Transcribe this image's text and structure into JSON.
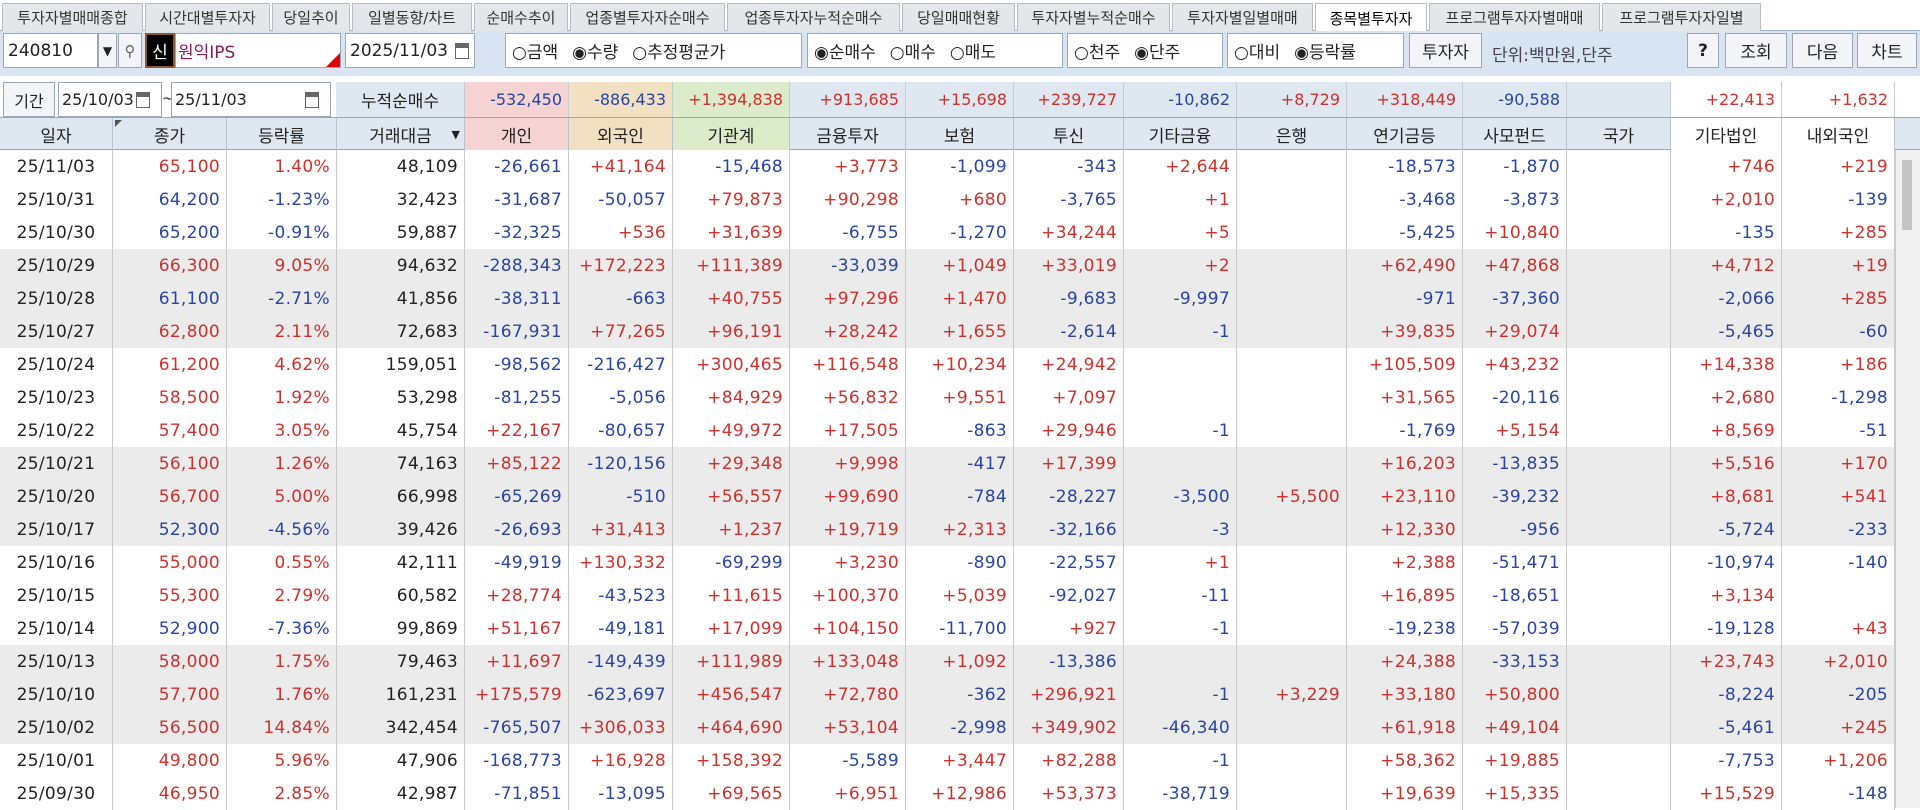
{
  "tabs": [
    "투자자별매매종합",
    "시간대별투자자",
    "당일추이",
    "일별동향/차트",
    "순매수추이",
    "업종별투자자순매수",
    "업종투자자누적순매수",
    "당일매매현황",
    "투자자별누적순매수",
    "투자자별일별매매",
    "종목별투자자",
    "프로그램투자자별매매",
    "프로그램투자자일별"
  ],
  "active_tab": "종목별투자자",
  "toolbar": {
    "code": "240810",
    "new_badge": "신",
    "stock_name": "원익IPS",
    "date": "2025/11/03",
    "group1": [
      {
        "label": "금액",
        "checked": false
      },
      {
        "label": "수량",
        "checked": true
      },
      {
        "label": "추정평균가",
        "checked": false
      }
    ],
    "group2": [
      {
        "label": "순매수",
        "checked": true
      },
      {
        "label": "매수",
        "checked": false
      },
      {
        "label": "매도",
        "checked": false
      }
    ],
    "group3": [
      {
        "label": "천주",
        "checked": false
      },
      {
        "label": "단주",
        "checked": true
      }
    ],
    "group4": [
      {
        "label": "대비",
        "checked": false
      },
      {
        "label": "등락률",
        "checked": true
      }
    ],
    "investor_btn": "투자자",
    "unit": "단위:백만원,단주",
    "help_btn": "?",
    "query_btn": "조회",
    "next_btn": "다음",
    "chart_btn": "차트"
  },
  "period": {
    "label": "기간",
    "from": "25/10/03",
    "sep": "~",
    "to": "25/11/03",
    "cum_label": "누적순매수"
  },
  "cumulative": [
    "-532,450",
    "-886,433",
    "+1,394,838",
    "+913,685",
    "+15,698",
    "+239,727",
    "-10,862",
    "+8,729",
    "+318,449",
    "-90,588",
    "",
    "+22,413",
    "+1,632"
  ],
  "columns": [
    "일자",
    "종가",
    "등락률",
    "거래대금",
    "개인",
    "외국인",
    "기관계",
    "금융투자",
    "보험",
    "투신",
    "기타금융",
    "은행",
    "연기금등",
    "사모펀드",
    "국가",
    "기타법인",
    "내외국인"
  ],
  "colors": {
    "pos": "#d0302c",
    "neg": "#2845a5",
    "individual": "#f6d3d3",
    "foreign": "#f2e0c3",
    "institution": "#dcebc9",
    "gray_row": "#ebebeb"
  },
  "rows": [
    [
      "25/11/03",
      "65,100",
      "1.40%",
      "48,109",
      "-26,661",
      "+41,164",
      "-15,468",
      "+3,773",
      "-1,099",
      "-343",
      "+2,644",
      "",
      "-18,573",
      "-1,870",
      "",
      "+746",
      "+219"
    ],
    [
      "25/10/31",
      "64,200",
      "-1.23%",
      "32,423",
      "-31,687",
      "-50,057",
      "+79,873",
      "+90,298",
      "+680",
      "-3,765",
      "+1",
      "",
      "-3,468",
      "-3,873",
      "",
      "+2,010",
      "-139"
    ],
    [
      "25/10/30",
      "65,200",
      "-0.91%",
      "59,887",
      "-32,325",
      "+536",
      "+31,639",
      "-6,755",
      "-1,270",
      "+34,244",
      "+5",
      "",
      "-5,425",
      "+10,840",
      "",
      "-135",
      "+285"
    ],
    [
      "25/10/29",
      "66,300",
      "9.05%",
      "94,632",
      "-288,343",
      "+172,223",
      "+111,389",
      "-33,039",
      "+1,049",
      "+33,019",
      "+2",
      "",
      "+62,490",
      "+47,868",
      "",
      "+4,712",
      "+19"
    ],
    [
      "25/10/28",
      "61,100",
      "-2.71%",
      "41,856",
      "-38,311",
      "-663",
      "+40,755",
      "+97,296",
      "+1,470",
      "-9,683",
      "-9,997",
      "",
      "-971",
      "-37,360",
      "",
      "-2,066",
      "+285"
    ],
    [
      "25/10/27",
      "62,800",
      "2.11%",
      "72,683",
      "-167,931",
      "+77,265",
      "+96,191",
      "+28,242",
      "+1,655",
      "-2,614",
      "-1",
      "",
      "+39,835",
      "+29,074",
      "",
      "-5,465",
      "-60"
    ],
    [
      "25/10/24",
      "61,200",
      "4.62%",
      "159,051",
      "-98,562",
      "-216,427",
      "+300,465",
      "+116,548",
      "+10,234",
      "+24,942",
      "",
      "",
      "+105,509",
      "+43,232",
      "",
      "+14,338",
      "+186"
    ],
    [
      "25/10/23",
      "58,500",
      "1.92%",
      "53,298",
      "-81,255",
      "-5,056",
      "+84,929",
      "+56,832",
      "+9,551",
      "+7,097",
      "",
      "",
      "+31,565",
      "-20,116",
      "",
      "+2,680",
      "-1,298"
    ],
    [
      "25/10/22",
      "57,400",
      "3.05%",
      "45,754",
      "+22,167",
      "-80,657",
      "+49,972",
      "+17,505",
      "-863",
      "+29,946",
      "-1",
      "",
      "-1,769",
      "+5,154",
      "",
      "+8,569",
      "-51"
    ],
    [
      "25/10/21",
      "56,100",
      "1.26%",
      "74,163",
      "+85,122",
      "-120,156",
      "+29,348",
      "+9,998",
      "-417",
      "+17,399",
      "",
      "",
      "+16,203",
      "-13,835",
      "",
      "+5,516",
      "+170"
    ],
    [
      "25/10/20",
      "56,700",
      "5.00%",
      "66,998",
      "-65,269",
      "-510",
      "+56,557",
      "+99,690",
      "-784",
      "-28,227",
      "-3,500",
      "+5,500",
      "+23,110",
      "-39,232",
      "",
      "+8,681",
      "+541"
    ],
    [
      "25/10/17",
      "52,300",
      "-4.56%",
      "39,426",
      "-26,693",
      "+31,413",
      "+1,237",
      "+19,719",
      "+2,313",
      "-32,166",
      "-3",
      "",
      "+12,330",
      "-956",
      "",
      "-5,724",
      "-233"
    ],
    [
      "25/10/16",
      "55,000",
      "0.55%",
      "42,111",
      "-49,919",
      "+130,332",
      "-69,299",
      "+3,230",
      "-890",
      "-22,557",
      "+1",
      "",
      "+2,388",
      "-51,471",
      "",
      "-10,974",
      "-140"
    ],
    [
      "25/10/15",
      "55,300",
      "2.79%",
      "60,582",
      "+28,774",
      "-43,523",
      "+11,615",
      "+100,370",
      "+5,039",
      "-92,027",
      "-11",
      "",
      "+16,895",
      "-18,651",
      "",
      "+3,134",
      ""
    ],
    [
      "25/10/14",
      "52,900",
      "-7.36%",
      "99,869",
      "+51,167",
      "-49,181",
      "+17,099",
      "+104,150",
      "-11,700",
      "+927",
      "-1",
      "",
      "-19,238",
      "-57,039",
      "",
      "-19,128",
      "+43"
    ],
    [
      "25/10/13",
      "58,000",
      "1.75%",
      "79,463",
      "+11,697",
      "-149,439",
      "+111,989",
      "+133,048",
      "+1,092",
      "-13,386",
      "",
      "",
      "+24,388",
      "-33,153",
      "",
      "+23,743",
      "+2,010"
    ],
    [
      "25/10/10",
      "57,700",
      "1.76%",
      "161,231",
      "+175,579",
      "-623,697",
      "+456,547",
      "+72,780",
      "-362",
      "+296,921",
      "-1",
      "+3,229",
      "+33,180",
      "+50,800",
      "",
      "-8,224",
      "-205"
    ],
    [
      "25/10/02",
      "56,500",
      "14.84%",
      "342,454",
      "-765,507",
      "+306,033",
      "+464,690",
      "+53,104",
      "-2,998",
      "+349,902",
      "-46,340",
      "",
      "+61,918",
      "+49,104",
      "",
      "-5,461",
      "+245"
    ],
    [
      "25/10/01",
      "49,800",
      "5.96%",
      "47,906",
      "-168,773",
      "+16,928",
      "+158,392",
      "-5,589",
      "+3,447",
      "+82,288",
      "-1",
      "",
      "+58,362",
      "+19,885",
      "",
      "-7,753",
      "+1,206"
    ],
    [
      "25/09/30",
      "46,950",
      "2.85%",
      "42,987",
      "-71,851",
      "-13,095",
      "+69,565",
      "+6,951",
      "+12,986",
      "+53,373",
      "-38,719",
      "",
      "+19,639",
      "+15,335",
      "",
      "+15,529",
      "-148"
    ]
  ],
  "gray_rows": [
    3,
    4,
    5,
    9,
    10,
    11,
    15,
    16,
    17
  ]
}
